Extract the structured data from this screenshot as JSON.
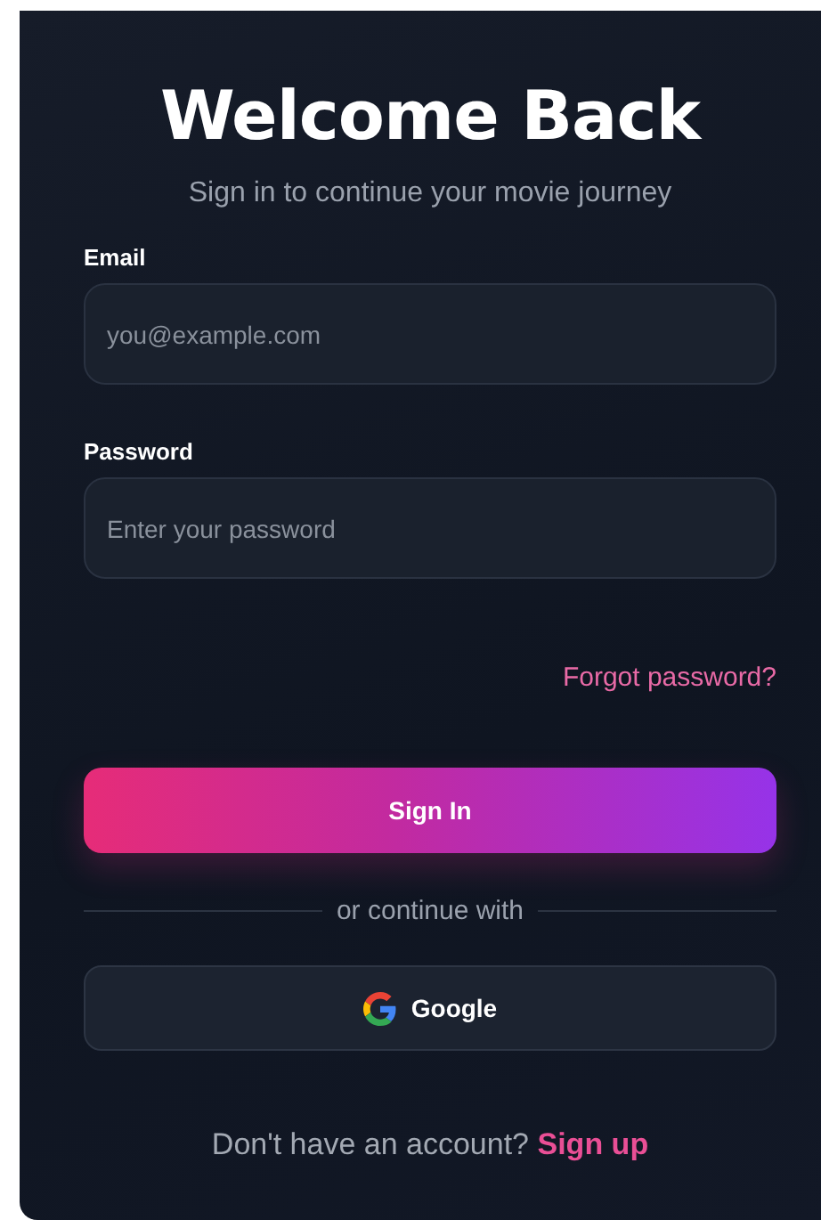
{
  "title": "Welcome Back",
  "subtitle": "Sign in to continue your movie journey",
  "fields": [
    {
      "label": "Email",
      "placeholder": "you@example.com"
    },
    {
      "label": "Password",
      "placeholder": "Enter your password"
    }
  ],
  "forgot_link": "Forgot password?",
  "submit_button": "Sign In",
  "divider_text": "or continue with",
  "social_button": "Google",
  "footer": {
    "text": "Don't have an account?",
    "link": "Sign up"
  }
}
